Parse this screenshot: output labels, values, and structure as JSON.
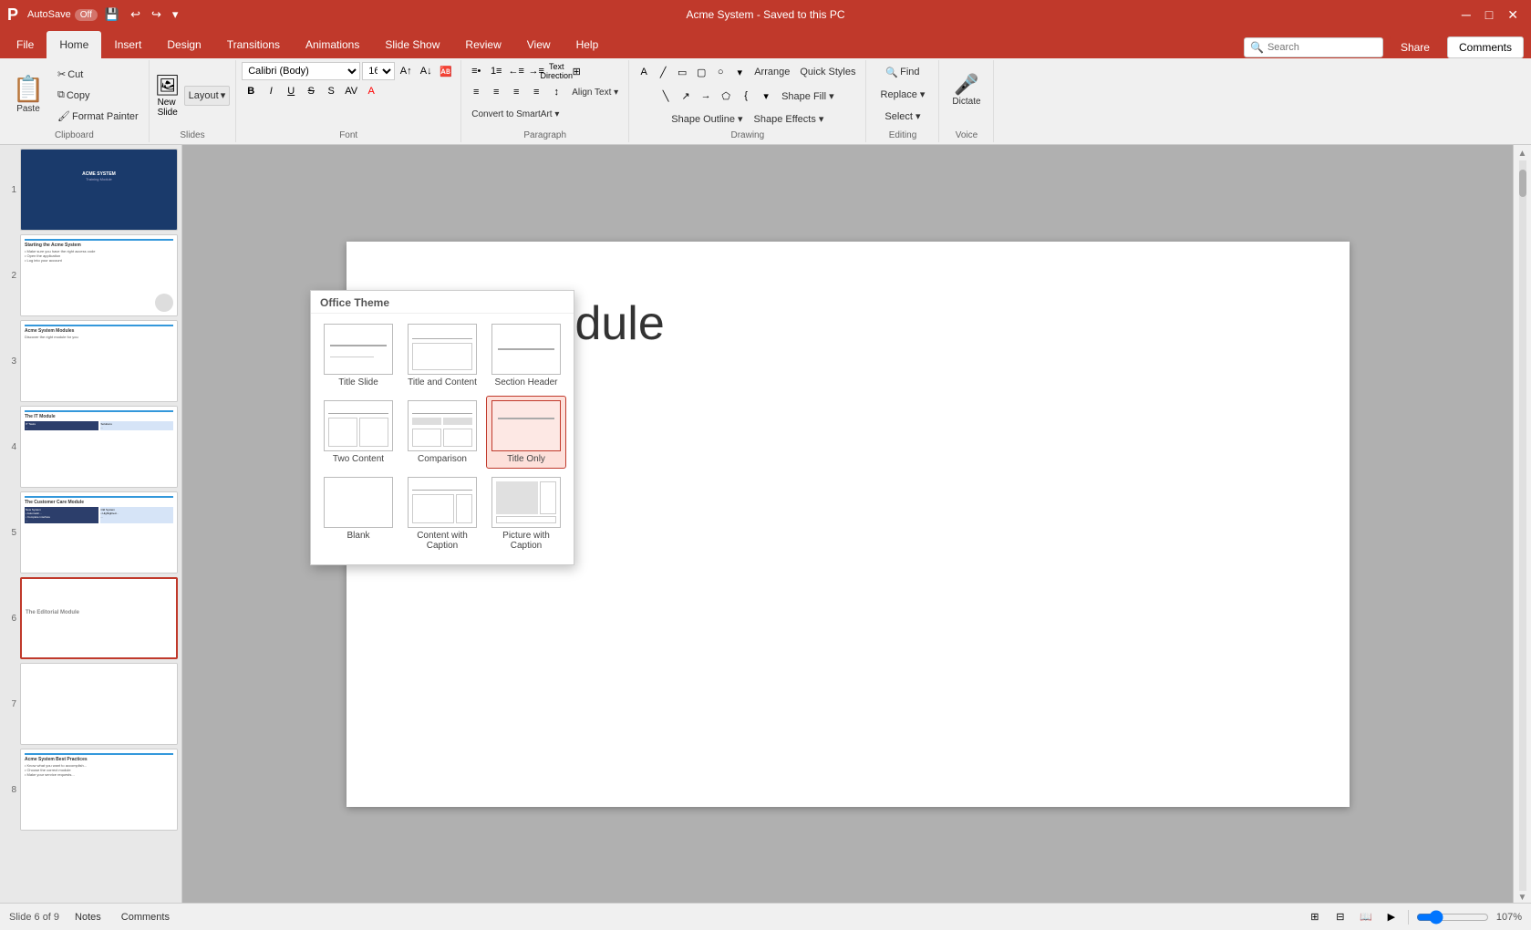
{
  "titleBar": {
    "appName": "AutoSave",
    "autoSaveOn": "Off",
    "documentName": "Acme System",
    "savedStatus": "Saved to this PC",
    "windowTitle": "Acme System - Saved to this PC"
  },
  "tabs": {
    "items": [
      "File",
      "Home",
      "Insert",
      "Design",
      "Transitions",
      "Animations",
      "Slide Show",
      "Review",
      "View",
      "Help"
    ]
  },
  "ribbon": {
    "clipboard": {
      "paste": "Paste",
      "cut": "Cut",
      "copy": "Copy",
      "formatPainter": "Format Painter"
    },
    "slides": {
      "newSlide": "New Slide",
      "layout": "Layout",
      "layoutDropdown": "▾"
    },
    "font": {
      "fontName": "Calibri (Body)",
      "fontSize": "16",
      "bold": "B",
      "italic": "I",
      "underline": "U",
      "strikethrough": "S",
      "shadow": "S"
    },
    "paragraph": {
      "alignLeft": "≡",
      "alignCenter": "≡",
      "alignRight": "≡",
      "textDirection": "Text Direction",
      "alignText": "Align Text ▾",
      "convertSmartArt": "Convert to SmartArt ▾"
    },
    "drawing": {
      "label": "Drawing",
      "arrange": "Arrange",
      "quickStyles": "Quick Styles",
      "shapeFill": "Shape Fill ▾",
      "shapeOutline": "Shape Outline ▾",
      "shapeEffects": "Shape Effects ▾"
    },
    "editing": {
      "find": "Find",
      "replace": "Replace ▾",
      "select": "Select ▾"
    },
    "voice": {
      "dictate": "Dictate"
    }
  },
  "layoutDropdown": {
    "title": "Office Theme",
    "items": [
      {
        "label": "Title Slide",
        "type": "title-slide",
        "selected": false
      },
      {
        "label": "Title and Content",
        "type": "title-content",
        "selected": false
      },
      {
        "label": "Section Header",
        "type": "section-header",
        "selected": false
      },
      {
        "label": "Two Content",
        "type": "two-content",
        "selected": false
      },
      {
        "label": "Comparison",
        "type": "comparison",
        "selected": false
      },
      {
        "label": "Title Only",
        "type": "title-only",
        "selected": true
      },
      {
        "label": "Blank",
        "type": "blank",
        "selected": false
      },
      {
        "label": "Content with Caption",
        "type": "content-caption",
        "selected": false
      },
      {
        "label": "Picture with Caption",
        "type": "picture-caption",
        "selected": false
      }
    ]
  },
  "slides": [
    {
      "number": 1,
      "type": "title-blue"
    },
    {
      "number": 2,
      "type": "starting-acme",
      "title": "Starting the Acme System"
    },
    {
      "number": 3,
      "type": "acme-modules",
      "title": "Acme System Modules"
    },
    {
      "number": 4,
      "type": "it-module",
      "title": "The IT Module"
    },
    {
      "number": 5,
      "type": "customer-care",
      "title": "The Customer Care Module"
    },
    {
      "number": 6,
      "type": "editorial",
      "title": "The Editorial Module",
      "active": true
    },
    {
      "number": 7,
      "type": "blank"
    },
    {
      "number": 8,
      "type": "best-practices",
      "title": "Acme System Best Practices"
    }
  ],
  "canvas": {
    "slideTitle": "itorial Module"
  },
  "statusBar": {
    "slideInfo": "Slide 6 of 9",
    "notes": "Notes",
    "zoom": "107%"
  },
  "search": {
    "placeholder": "Search",
    "label": "Search"
  },
  "shareBtn": "Share",
  "commentsBtn": "Comments"
}
